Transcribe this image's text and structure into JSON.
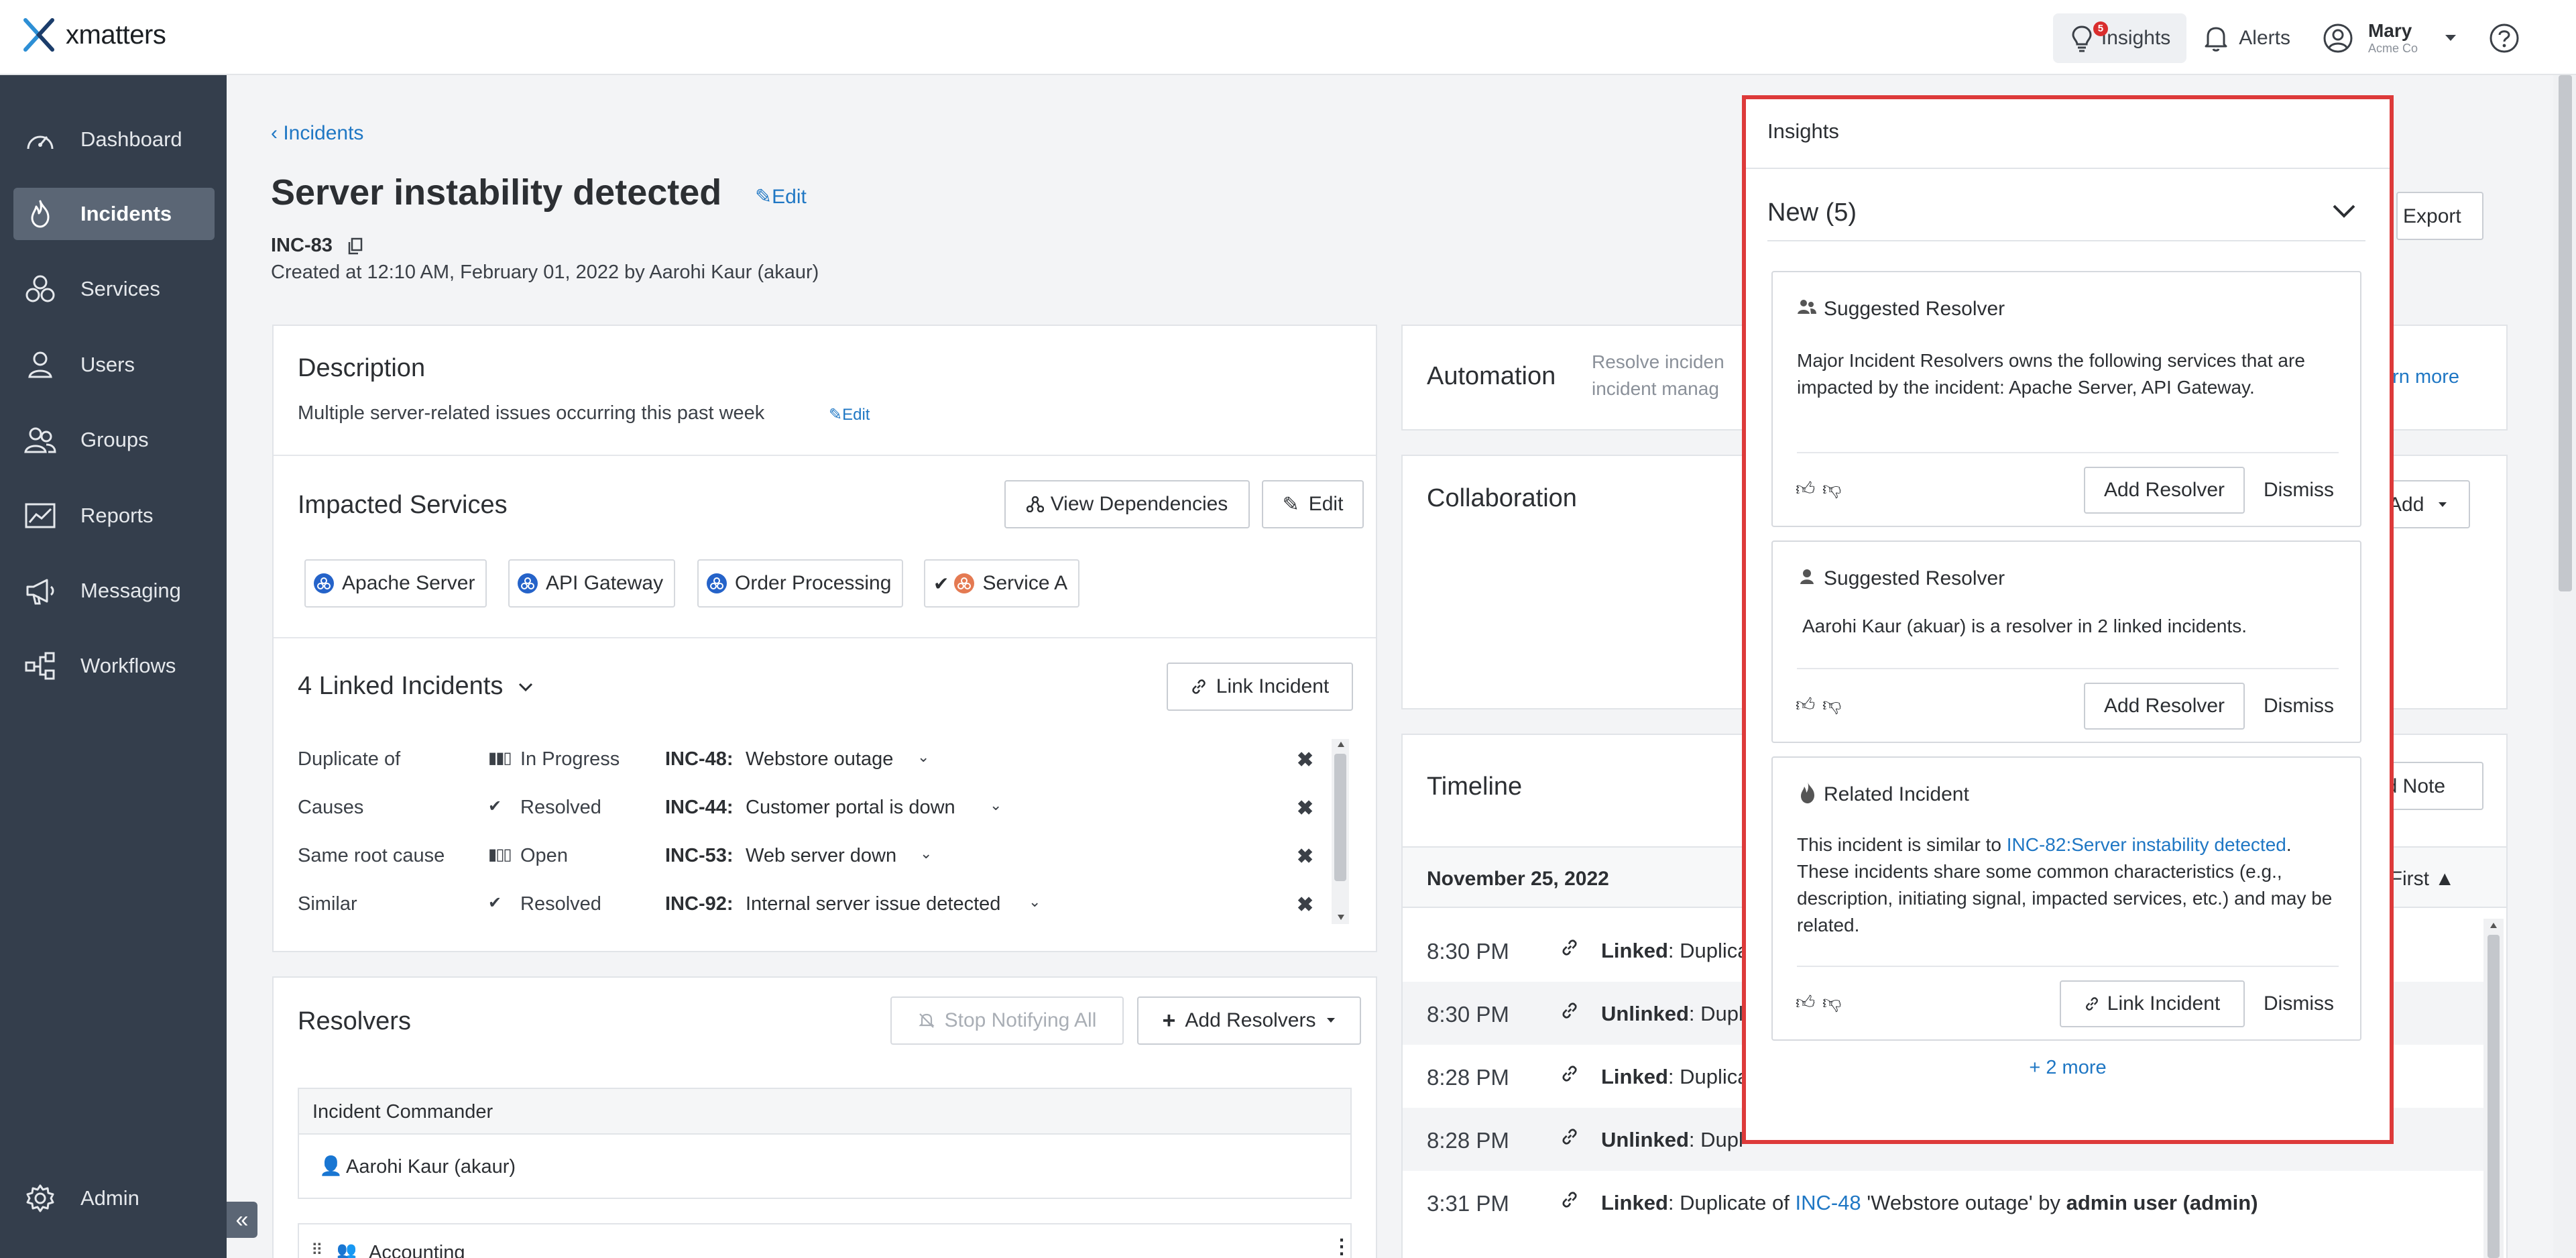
{
  "app": {
    "brand": "xmatters",
    "accent": "#1f77c4",
    "sidebar_bg": "#343e4c",
    "highlight": "#dd3a3a"
  },
  "topnav": {
    "insights": {
      "label": "Insights",
      "badge": "5",
      "icon": "lightbulb-icon"
    },
    "alerts": {
      "label": "Alerts",
      "icon": "bell-icon"
    },
    "user": {
      "name": "Mary",
      "org": "Acme Co",
      "icon": "user-circle-icon"
    },
    "help_icon": "help-icon"
  },
  "sidebar": {
    "items": [
      {
        "label": "Dashboard",
        "icon": "gauge-icon"
      },
      {
        "label": "Incidents",
        "icon": "flame-icon",
        "active": true
      },
      {
        "label": "Services",
        "icon": "services-icon"
      },
      {
        "label": "Users",
        "icon": "user-icon"
      },
      {
        "label": "Groups",
        "icon": "groups-icon"
      },
      {
        "label": "Reports",
        "icon": "chart-icon"
      },
      {
        "label": "Messaging",
        "icon": "megaphone-icon"
      },
      {
        "label": "Workflows",
        "icon": "workflow-icon"
      }
    ],
    "admin": {
      "label": "Admin",
      "icon": "gear-icon"
    },
    "collapse": "«"
  },
  "incident": {
    "breadcrumb": "‹ Incidents",
    "title": "Server instability detected",
    "edit_label": "Edit",
    "id": "INC-83",
    "created": "Created at 12:10 AM, February 01, 2022 by Aarohi Kaur (akaur)"
  },
  "description": {
    "title": "Description",
    "text": "Multiple server-related issues occurring this past week",
    "edit_label": "Edit"
  },
  "impacted": {
    "title": "Impacted Services",
    "view_dependencies": "View Dependencies",
    "edit": "Edit",
    "services": [
      "Apache Server",
      "API Gateway",
      "Order Processing",
      "Service A"
    ]
  },
  "linked": {
    "title": "4 Linked Incidents",
    "link_button": "Link Incident",
    "rows": [
      {
        "relation": "Duplicate of",
        "status": "In Progress",
        "id": "INC-48:",
        "name": "Webstore outage"
      },
      {
        "relation": "Causes",
        "status": "Resolved",
        "id": "INC-44:",
        "name": "Customer portal is down"
      },
      {
        "relation": "Same root cause",
        "status": "Open",
        "id": "INC-53:",
        "name": "Web server down"
      },
      {
        "relation": "Similar",
        "status": "Resolved",
        "id": "INC-92:",
        "name": "Internal server issue detected"
      }
    ]
  },
  "resolvers": {
    "title": "Resolvers",
    "stop_notifying": "Stop Notifying All",
    "add_resolvers": "Add Resolvers",
    "commander_header": "Incident Commander",
    "commander": "Aarohi Kaur (akaur)",
    "next_group": "Accounting"
  },
  "automation": {
    "title": "Automation",
    "text1": "Resolve inciden",
    "text2": "incident manag",
    "learn_more": "arn more"
  },
  "collaboration": {
    "title": "Collaboration",
    "add_label": "Add"
  },
  "export": {
    "label": "Export"
  },
  "timeline": {
    "title": "Timeline",
    "add_note": "ld Note",
    "date": "November 25, 2022",
    "sort": ": First",
    "rows": [
      {
        "time": "8:30 PM",
        "action": "Linked",
        "text": ": Duplica"
      },
      {
        "time": "8:30 PM",
        "action": "Unlinked",
        "text": ": Dupl"
      },
      {
        "time": "8:28 PM",
        "action": "Linked",
        "text": ": Duplica"
      },
      {
        "time": "8:28 PM",
        "action": "Unlinked",
        "text": ": Dupl"
      },
      {
        "time": "3:31 PM",
        "action": "Linked",
        "text": ": Duplicate of ",
        "link": "INC-48",
        "rest": " 'Webstore outage' by ",
        "user": "admin user (admin)"
      }
    ]
  },
  "insights_panel": {
    "header": "Insights",
    "new_label": "New (5)",
    "cards": [
      {
        "type": "Suggested Resolver",
        "body": "Major Incident Resolvers owns the following services that are impacted by the incident: Apache Server, API Gateway.",
        "action": "Add Resolver",
        "dismiss": "Dismiss"
      },
      {
        "type": "Suggested Resolver",
        "body": "Aarohi Kaur (akuar) is a resolver in 2 linked incidents.",
        "action": "Add Resolver",
        "dismiss": "Dismiss"
      },
      {
        "type": "Related Incident",
        "body_pre": "This incident is similar to ",
        "body_link": "INC-82:Server instability detected",
        "body_post": ". These incidents share some common characteristics (e.g., description, initiating signal, impacted services, etc.) and may be related.",
        "action": "Link Incident",
        "dismiss": "Dismiss"
      }
    ],
    "more": "+ 2 more"
  }
}
